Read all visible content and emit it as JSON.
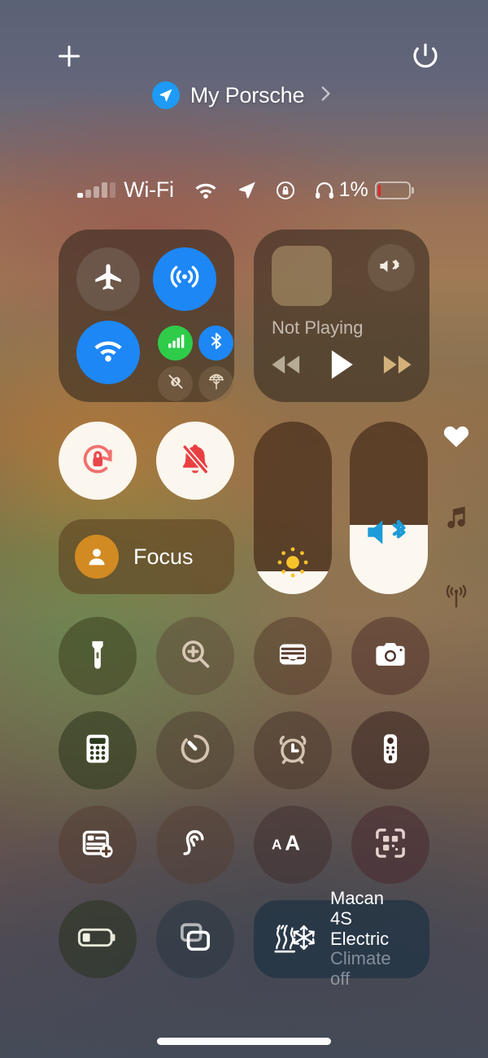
{
  "header": {
    "add_icon": "plus-icon",
    "power_icon": "power-icon",
    "connect": {
      "badge_icon": "location-arrow-icon",
      "name": "My Porsche",
      "chevron_icon": "chevron-right-icon"
    }
  },
  "status_bar": {
    "signal_icon": "cellular-bars-icon",
    "carrier_label": "Wi-Fi",
    "wifi_icon": "wifi-icon",
    "location_icon": "location-arrow-icon",
    "rotation_lock_icon": "rotation-lock-icon",
    "headphones_icon": "headphones-icon",
    "battery_percent": "1%",
    "battery_icon": "battery-low-icon",
    "battery_color": "#e8262a",
    "battery_level": 8
  },
  "connectivity": {
    "airplane": {
      "name": "Airplane Mode",
      "icon": "airplane-icon",
      "state": "off"
    },
    "airdrop": {
      "name": "AirDrop",
      "icon": "airdrop-icon",
      "state": "on",
      "color": "#1d87f5"
    },
    "wifi": {
      "name": "Wi-Fi",
      "icon": "wifi-icon",
      "state": "on",
      "color": "#1d87f5"
    },
    "cellular": {
      "name": "Cellular Data",
      "icon": "cellular-bars-icon",
      "state": "on",
      "color": "#2fcc4a"
    },
    "bluetooth": {
      "name": "Bluetooth",
      "icon": "bluetooth-icon",
      "state": "on",
      "color": "#1d87f5"
    },
    "hotspot": {
      "name": "Personal Hotspot",
      "icon": "hotspot-link-slash-icon",
      "state": "off"
    },
    "vpn": {
      "name": "VPN",
      "icon": "vpn-globe-icon",
      "state": "off"
    }
  },
  "media": {
    "artwork": "album-art-placeholder",
    "airplay_icon": "speaker-bluetooth-icon",
    "now_playing": "Not Playing",
    "rewind_icon": "rewind-icon",
    "play_icon": "play-icon",
    "forward_icon": "fast-forward-icon"
  },
  "toggles": {
    "rotation_lock": {
      "name": "Rotation Lock",
      "icon": "rotation-lock-icon",
      "state": "on",
      "color": "#ef4a4a"
    },
    "silent_mode": {
      "name": "Silent Mode",
      "icon": "bell-slash-icon",
      "state": "on",
      "color": "#ef3b3b"
    }
  },
  "focus": {
    "icon": "person-icon",
    "label": "Focus",
    "badge_color": "#d28a22"
  },
  "sliders": {
    "brightness": {
      "name": "Brightness",
      "icon": "sun-icon",
      "level_percent": 13,
      "icon_color": "#f8c52b"
    },
    "volume": {
      "name": "Volume",
      "icon": "speaker-bluetooth-icon",
      "level_percent": 40,
      "icon_color": "#1d9bd8"
    }
  },
  "page_indicators": [
    {
      "icon": "heart-icon",
      "active": true
    },
    {
      "icon": "music-note-icon",
      "active": false
    },
    {
      "icon": "broadcast-icon",
      "active": false
    }
  ],
  "utilities": [
    {
      "name": "Flashlight",
      "icon": "flashlight-icon"
    },
    {
      "name": "Magnifier",
      "icon": "magnifier-icon"
    },
    {
      "name": "Wallet",
      "icon": "wallet-icon"
    },
    {
      "name": "Camera",
      "icon": "camera-icon"
    },
    {
      "name": "Calculator",
      "icon": "calculator-icon"
    },
    {
      "name": "Timer",
      "icon": "timer-icon"
    },
    {
      "name": "Alarm",
      "icon": "alarm-clock-icon"
    },
    {
      "name": "Apple TV Remote",
      "icon": "tv-remote-icon"
    },
    {
      "name": "Quick Note",
      "icon": "quick-note-icon"
    },
    {
      "name": "Hearing",
      "icon": "ear-icon"
    },
    {
      "name": "Text Size",
      "icon": "text-size-icon"
    },
    {
      "name": "Code Scanner",
      "icon": "qr-scanner-icon"
    },
    {
      "name": "Low Power Mode",
      "icon": "battery-icon"
    },
    {
      "name": "Screen Mirroring",
      "icon": "screen-mirroring-icon"
    }
  ],
  "car_tile": {
    "icon": "climate-heat-cool-icon",
    "model": "Macan",
    "trim": "4S Electric",
    "status": "Climate off"
  },
  "home_indicator": "home-indicator"
}
